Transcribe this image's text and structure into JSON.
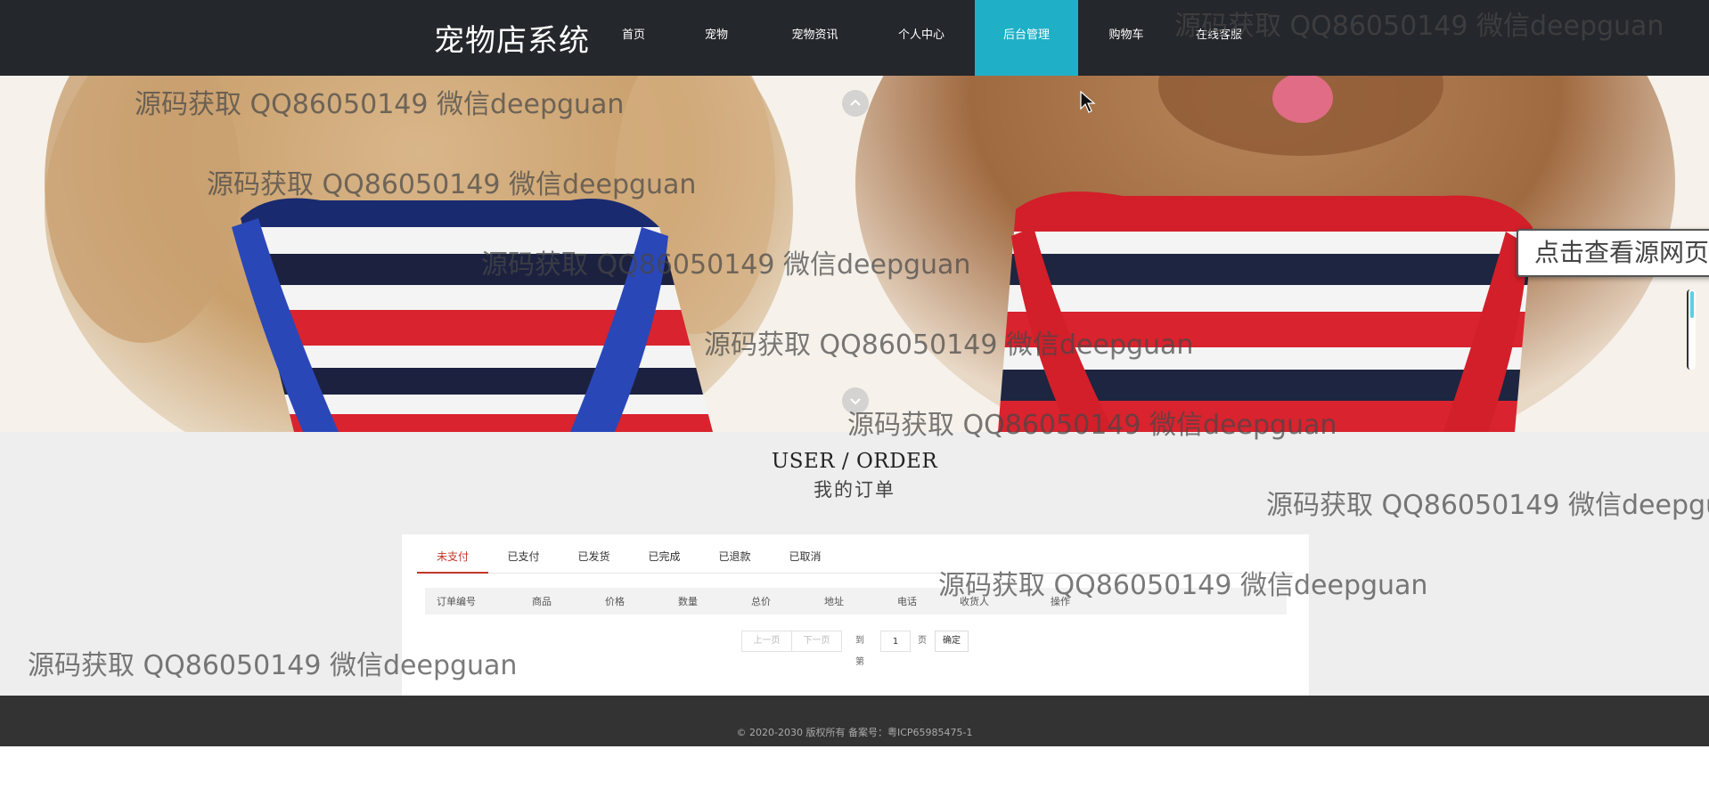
{
  "header": {
    "brand": "宠物店系统",
    "nav": [
      {
        "label": "首页",
        "active": false
      },
      {
        "label": "宠物",
        "active": false
      },
      {
        "label": "宠物资讯",
        "active": false
      },
      {
        "label": "个人中心",
        "active": false
      },
      {
        "label": "后台管理",
        "active": true
      },
      {
        "label": "购物车",
        "active": false
      },
      {
        "label": "在线客服",
        "active": false
      }
    ],
    "active_color": "#1fb0c8"
  },
  "banner": {
    "source_button": "点击查看源网页"
  },
  "orders": {
    "title": "USER / ORDER",
    "subtitle": "我的订单",
    "tabs": [
      {
        "label": "未支付",
        "active": true
      },
      {
        "label": "已支付",
        "active": false
      },
      {
        "label": "已发货",
        "active": false
      },
      {
        "label": "已完成",
        "active": false
      },
      {
        "label": "已退款",
        "active": false
      },
      {
        "label": "已取消",
        "active": false
      }
    ],
    "columns": [
      "订单编号",
      "商品",
      "价格",
      "数量",
      "总价",
      "地址",
      "电话",
      "收货人",
      "操作"
    ],
    "rows": [],
    "pagination": {
      "prev": "上一页",
      "next": "下一页",
      "goto_label": "到第",
      "page_value": "1",
      "page_unit": "页",
      "confirm": "确定"
    }
  },
  "footer": {
    "text": "© 2020-2030 版权所有 备案号：粤ICP65985475-1"
  },
  "watermark": {
    "text": "源码获取 QQ86050149 微信deepguan"
  }
}
